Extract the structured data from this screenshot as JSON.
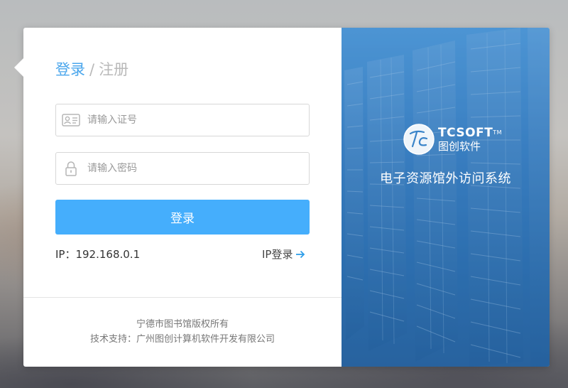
{
  "tabs": {
    "login": "登录",
    "separator": "/",
    "register": "注册"
  },
  "form": {
    "id_placeholder": "请输入证号",
    "password_placeholder": "请输入密码",
    "login_button": "登录"
  },
  "ip": {
    "label": "IP：192.168.0.1",
    "link_label": "IP登录"
  },
  "footer": {
    "line1": "宁德市图书馆版权所有",
    "line2": "技术支持：广州图创计算机软件开发有限公司"
  },
  "brand": {
    "logo_en": "TCSOFT",
    "logo_tm": "TM",
    "logo_cn": "图创软件",
    "system_title": "电子资源馆外访问系统"
  },
  "colors": {
    "accent": "#45aefc",
    "tab_active": "#4aa6ec",
    "panel_blue": "#3f86c8"
  },
  "icons": [
    "id-card-icon",
    "lock-icon",
    "arrow-right-icon",
    "tcsoft-logo-icon"
  ]
}
